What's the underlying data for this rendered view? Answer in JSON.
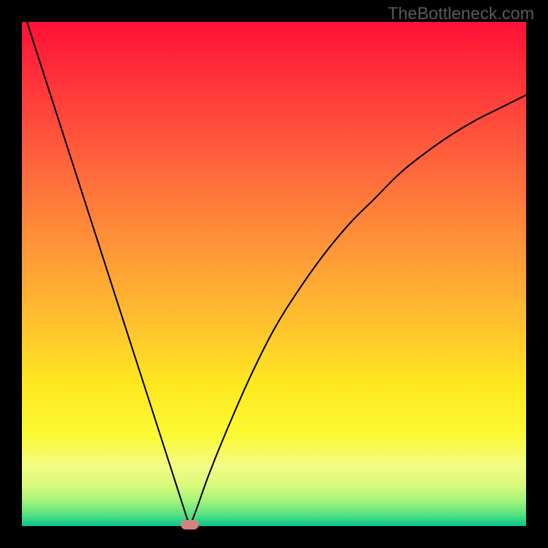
{
  "watermark": "TheBottleneck.com",
  "chart_data": {
    "type": "line",
    "title": "",
    "xlabel": "",
    "ylabel": "",
    "xlim": [
      0,
      1
    ],
    "ylim": [
      0,
      1
    ],
    "series": [
      {
        "name": "bottleneck-curve",
        "points": [
          {
            "x": 0.01,
            "y": 1.0
          },
          {
            "x": 0.05,
            "y": 0.876
          },
          {
            "x": 0.1,
            "y": 0.721
          },
          {
            "x": 0.15,
            "y": 0.566
          },
          {
            "x": 0.2,
            "y": 0.411
          },
          {
            "x": 0.25,
            "y": 0.256
          },
          {
            "x": 0.3,
            "y": 0.101
          },
          {
            "x": 0.325,
            "y": 0.023
          },
          {
            "x": 0.333,
            "y": 0.0
          },
          {
            "x": 0.345,
            "y": 0.03
          },
          {
            "x": 0.37,
            "y": 0.1
          },
          {
            "x": 0.4,
            "y": 0.175
          },
          {
            "x": 0.45,
            "y": 0.29
          },
          {
            "x": 0.5,
            "y": 0.39
          },
          {
            "x": 0.55,
            "y": 0.47
          },
          {
            "x": 0.6,
            "y": 0.54
          },
          {
            "x": 0.65,
            "y": 0.6
          },
          {
            "x": 0.7,
            "y": 0.65
          },
          {
            "x": 0.75,
            "y": 0.7
          },
          {
            "x": 0.8,
            "y": 0.74
          },
          {
            "x": 0.85,
            "y": 0.775
          },
          {
            "x": 0.9,
            "y": 0.805
          },
          {
            "x": 0.95,
            "y": 0.83
          },
          {
            "x": 1.0,
            "y": 0.855
          }
        ]
      }
    ],
    "marker": {
      "x": 0.333,
      "y": 0.0
    },
    "gradient_stops": [
      {
        "pos": 0.0,
        "color": "#ff1037"
      },
      {
        "pos": 0.15,
        "color": "#ff3d3b"
      },
      {
        "pos": 0.3,
        "color": "#ff6a3c"
      },
      {
        "pos": 0.45,
        "color": "#ff9638"
      },
      {
        "pos": 0.6,
        "color": "#ffc22e"
      },
      {
        "pos": 0.72,
        "color": "#ffe81f"
      },
      {
        "pos": 0.82,
        "color": "#fbfa34"
      },
      {
        "pos": 0.88,
        "color": "#f4fb84"
      },
      {
        "pos": 0.92,
        "color": "#d9f97c"
      },
      {
        "pos": 0.95,
        "color": "#a3f478"
      },
      {
        "pos": 0.98,
        "color": "#4fe082"
      },
      {
        "pos": 1.0,
        "color": "#03c58e"
      }
    ]
  }
}
